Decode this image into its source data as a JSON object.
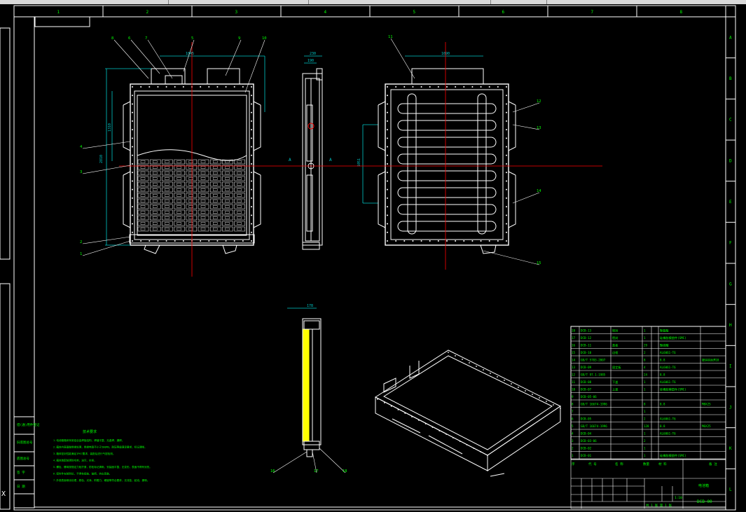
{
  "colors": {
    "bg": "#000000",
    "frame": "#ffffff",
    "green": "#00ff00",
    "cyan": "#00c8c8",
    "red": "#ff0000",
    "yellow": "#ffff00"
  },
  "grid": {
    "cols": [
      "1",
      "2",
      "3",
      "4",
      "5",
      "6",
      "7",
      "8"
    ],
    "rows": [
      "A",
      "B",
      "C",
      "D",
      "E",
      "F",
      "G",
      "H",
      "I",
      "J",
      "K",
      "L"
    ]
  },
  "balloons": {
    "front": [
      "8",
      "6",
      "7",
      "5",
      "9",
      "10",
      "4",
      "3",
      "2",
      "1"
    ],
    "rear": [
      "11",
      "12",
      "13",
      "14",
      "15"
    ],
    "section": [
      "16",
      "17",
      "18"
    ]
  },
  "dims": {
    "front_w": "1845",
    "front_h": "2810",
    "front_v": "1310",
    "side_w": "230",
    "side_w2": "190",
    "rear_w": "1690",
    "rear_v": "1051",
    "sec_w": "178"
  },
  "section_marks": [
    "A",
    "A"
  ],
  "bom": [
    {
      "no": "18",
      "code": "DCB-13",
      "name": "密封",
      "qty": "1",
      "mat": "聚氨酯",
      "note": ""
    },
    {
      "no": "17",
      "code": "DCB-12",
      "name": "密封",
      "qty": "1",
      "mat": "硅橡胶模塑件(SMC)",
      "note": ""
    },
    {
      "no": "16",
      "code": "DCB-11",
      "name": "盖板",
      "qty": "29",
      "mat": "聚碳酸",
      "note": ""
    },
    {
      "no": "15",
      "code": "DCB-10",
      "name": "边框",
      "qty": "2",
      "mat": "AL6061-T6",
      "note": ""
    },
    {
      "no": "14",
      "code": "GB/T 5783-2007",
      "name": "",
      "qty": "8",
      "mat": "8.8",
      "note": "镀锌钝化M10"
    },
    {
      "no": "13",
      "code": "DCB-09",
      "name": "固定板",
      "qty": "4",
      "mat": "AL6061-T6",
      "note": ""
    },
    {
      "no": "12",
      "code": "GB/T 97.1-1985",
      "name": "",
      "qty": "24",
      "mat": "8.8",
      "note": ""
    },
    {
      "no": "11",
      "code": "DCB-08",
      "name": "下盖",
      "qty": "1",
      "mat": "AL6061-T6",
      "note": ""
    },
    {
      "no": "10",
      "code": "DCB-07",
      "name": "上盖",
      "qty": "1",
      "mat": "硅橡胶模塑件(SMC)",
      "note": ""
    },
    {
      "no": "9",
      "code": "DCB-05-06",
      "name": "",
      "qty": "",
      "mat": "",
      "note": ""
    },
    {
      "no": "8",
      "code": "GB/T 16674-1996",
      "name": "",
      "qty": "8",
      "mat": "8.8",
      "note": "M8X25"
    },
    {
      "no": "7",
      "code": "",
      "name": "",
      "qty": "1",
      "mat": "",
      "note": ""
    },
    {
      "no": "6",
      "code": "DCB-05",
      "name": "",
      "qty": "2",
      "mat": "AL6061-T6",
      "note": ""
    },
    {
      "no": "5",
      "code": "GB/T 16674-1996",
      "name": "",
      "qty": "128",
      "mat": "8.8",
      "note": "M6X25"
    },
    {
      "no": "4",
      "code": "DCB-04",
      "name": "",
      "qty": "1",
      "mat": "AL6061-T6",
      "note": ""
    },
    {
      "no": "3",
      "code": "DCB-03-06",
      "name": "",
      "qty": "2",
      "mat": "",
      "note": ""
    },
    {
      "no": "2",
      "code": "DCB-02",
      "name": "",
      "qty": "1",
      "mat": "",
      "note": ""
    },
    {
      "no": "1",
      "code": "DCB-01",
      "name": "",
      "qty": "1",
      "mat": "硅橡胶模塑件(SMC)",
      "note": ""
    }
  ],
  "bom_header": [
    "序",
    "代 号",
    "名 称",
    "数量",
    "材 料",
    "备 注"
  ],
  "title_block": {
    "drawing_no": "DCB-00",
    "name": "电池箱",
    "scale": "1:10",
    "sheet": "共 1 张 第 1 张"
  },
  "notes_title": "技术要求",
  "notes": [
    "1.电池箱箱体采用铝合金焊接结构，焊缝平整，无虚焊、漏焊。",
    "2.箱体内表面做绝缘处理，绝缘电阻不小于500MΩ，耐压等级满足要求，标记清晰。",
    "3.箱体密封性能满足IP67要求，装配后进行气密检测。",
    "4.箱体装配前清除毛刺、油污、杂质。",
    "5.螺栓、螺母按规定力矩拧紧，防松标记清晰，安装面平整，无变形，表面不得有划伤。",
    "6.密封件安装到位，不得有扭曲、破损、挤出现象。",
    "7.外观表面喷涂处理，颜色、光泽、附着力、硬度等符合要求，无流挂、起泡、漏喷。"
  ],
  "left_margin_labels": [
    "借(通)用件登记",
    "旧底图总号",
    "底图总号",
    "签 字",
    "日 期"
  ]
}
